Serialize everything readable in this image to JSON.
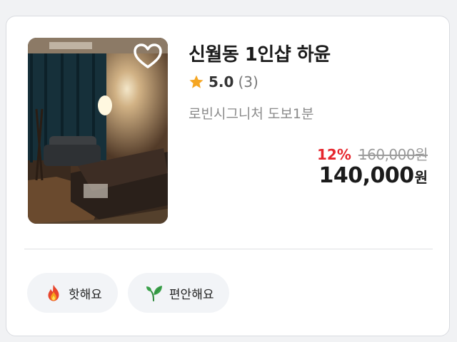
{
  "listing": {
    "title": "신월동 1인샵 하윤",
    "rating": {
      "score": "5.0",
      "count": "(3)",
      "icon": "star-icon",
      "star_color": "#f5a623"
    },
    "location": "로빈시그니처 도보1분",
    "price": {
      "discount_rate": "12%",
      "original_price": "160,000원",
      "sale_price": "140,000",
      "currency": "원",
      "discount_color": "#e6262d"
    },
    "favorite_icon": "heart-outline-icon",
    "photo": "room-photo"
  },
  "tags": [
    {
      "label": "핫해요",
      "icon": "fire-icon"
    },
    {
      "label": "편안해요",
      "icon": "leaf-sprout-icon"
    }
  ]
}
